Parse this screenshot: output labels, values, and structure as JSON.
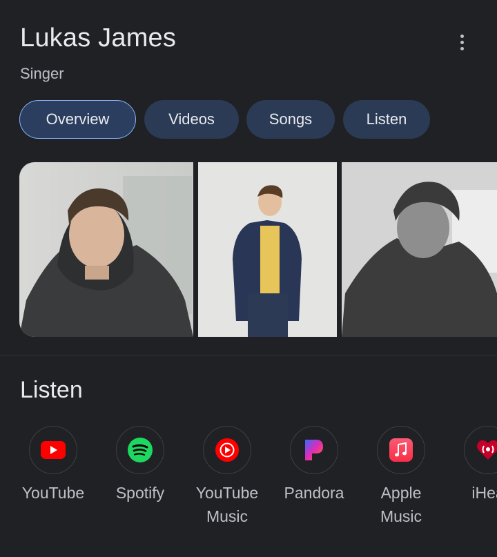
{
  "header": {
    "title": "Lukas James",
    "subtitle": "Singer"
  },
  "tabs": [
    {
      "label": "Overview",
      "active": true
    },
    {
      "label": "Videos",
      "active": false
    },
    {
      "label": "Songs",
      "active": false
    },
    {
      "label": "Listen",
      "active": false
    }
  ],
  "images": [
    {
      "icon": "photo-person-hoodie"
    },
    {
      "icon": "photo-person-denim-jacket"
    },
    {
      "icon": "photo-person-bw"
    }
  ],
  "listen": {
    "title": "Listen",
    "apps": [
      {
        "label": "YouTube",
        "icon": "youtube-icon",
        "color": "#ff0000"
      },
      {
        "label": "Spotify",
        "icon": "spotify-icon",
        "color": "#1ed760"
      },
      {
        "label": "YouTube\nMusic",
        "icon": "youtube-music-icon",
        "color": "#ff0000"
      },
      {
        "label": "Pandora",
        "icon": "pandora-icon",
        "color": "#e32bb4"
      },
      {
        "label": "Apple\nMusic",
        "icon": "apple-music-icon",
        "color": "#fa3c55"
      },
      {
        "label": "iHea",
        "icon": "iheart-icon",
        "color": "#c6002b"
      }
    ]
  },
  "colors": {
    "background": "#1f2125",
    "tab_bg": "#2b3a55",
    "tab_active_border": "#8ab4f8"
  }
}
